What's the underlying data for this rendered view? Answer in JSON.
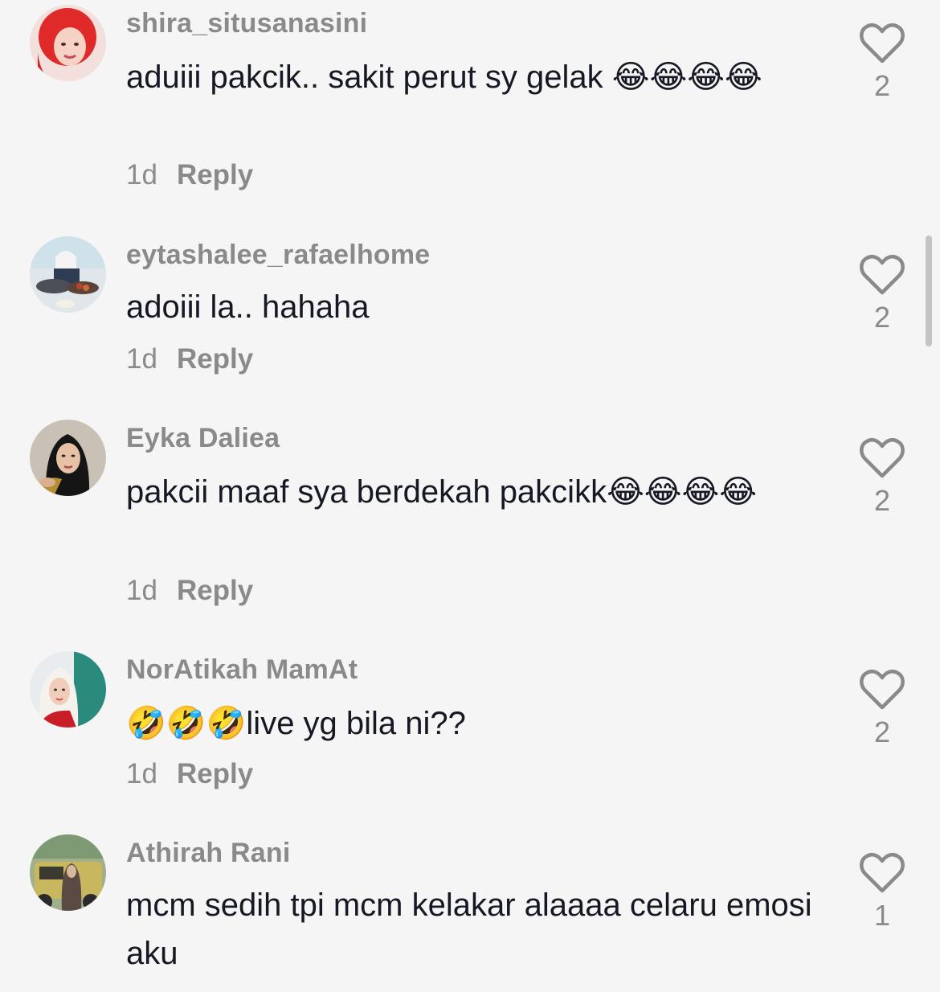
{
  "comments": [
    {
      "username": "shira_situsanasini",
      "text": "aduiii pakcik.. sakit perut sy gelak 😂😂😂😂",
      "time": "1d",
      "reply": "Reply",
      "likes": "2",
      "avatar_icon": "avatar-red-hair-woman"
    },
    {
      "username": "eytashalee_rafaelhome",
      "text": "adoiii la.. hahaha",
      "time": "1d",
      "reply": "Reply",
      "likes": "2",
      "avatar_icon": "avatar-woman-cooking"
    },
    {
      "username": "Eyka Daliea",
      "text": "pakcii maaf sya berdekah pakcikk😂😂😂😂",
      "time": "1d",
      "reply": "Reply",
      "likes": "2",
      "avatar_icon": "avatar-woman-hijab-dark"
    },
    {
      "username": "NorAtikah MamAt",
      "text": "🤣🤣🤣live yg bila ni??",
      "time": "1d",
      "reply": "Reply",
      "likes": "2",
      "avatar_icon": "avatar-woman-hijab-light"
    },
    {
      "username": "Athirah Rani",
      "text": "mcm sedih tpi mcm kelakar alaaaa celaru emosi aku",
      "time": "",
      "reply": "",
      "likes": "1",
      "avatar_icon": "avatar-woman-jeep"
    }
  ],
  "colors": {
    "background": "#f5f5f5",
    "text": "#161823",
    "muted": "#8a8a8a"
  }
}
